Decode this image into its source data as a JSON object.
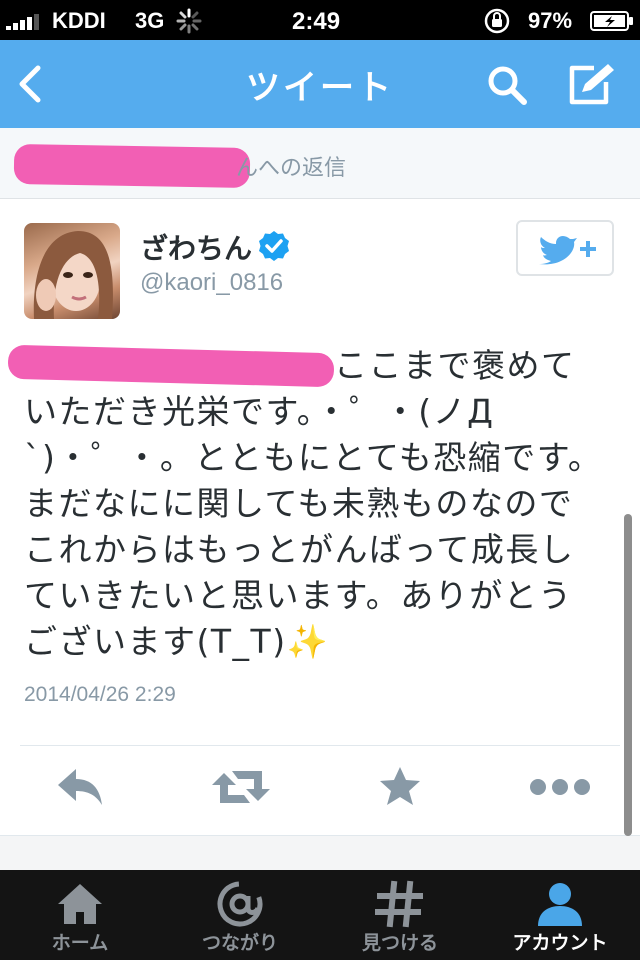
{
  "status_bar": {
    "carrier": "KDDI",
    "network": "3G",
    "time": "2:49",
    "battery": "97%"
  },
  "nav": {
    "title": "ツイート",
    "back_icon": "back-chevron-icon",
    "search_icon": "search-icon",
    "compose_icon": "compose-icon"
  },
  "reply_banner": {
    "text": "んへの返信"
  },
  "tweet": {
    "author_name": "ざわちん",
    "author_handle": "@kaori_0816",
    "verified": true,
    "text": "ここまで褒めていただき光栄です。・゜・(ノД`)・゜・。とともにとても恐縮です。まだなにに関しても未熟ものなのでこれからはもっとがんばって成長していきたいと思います。ありがとうございます(T_T)✨",
    "date": "2014/04/26 2:29"
  },
  "actions": [
    "reply-icon",
    "retweet-icon",
    "favorite-icon",
    "more-icon"
  ],
  "tabs": [
    {
      "label": "ホーム",
      "icon": "home-icon",
      "active": false
    },
    {
      "label": "つながり",
      "icon": "at-icon",
      "active": false
    },
    {
      "label": "見つける",
      "icon": "hashtag-icon",
      "active": false
    },
    {
      "label": "アカウント",
      "icon": "person-icon",
      "active": true
    }
  ],
  "colors": {
    "brand_blue": "#55acee",
    "verified_blue": "#1da1f2",
    "redaction_pink": "#f25fb4",
    "tabbar_bg": "#141414"
  }
}
